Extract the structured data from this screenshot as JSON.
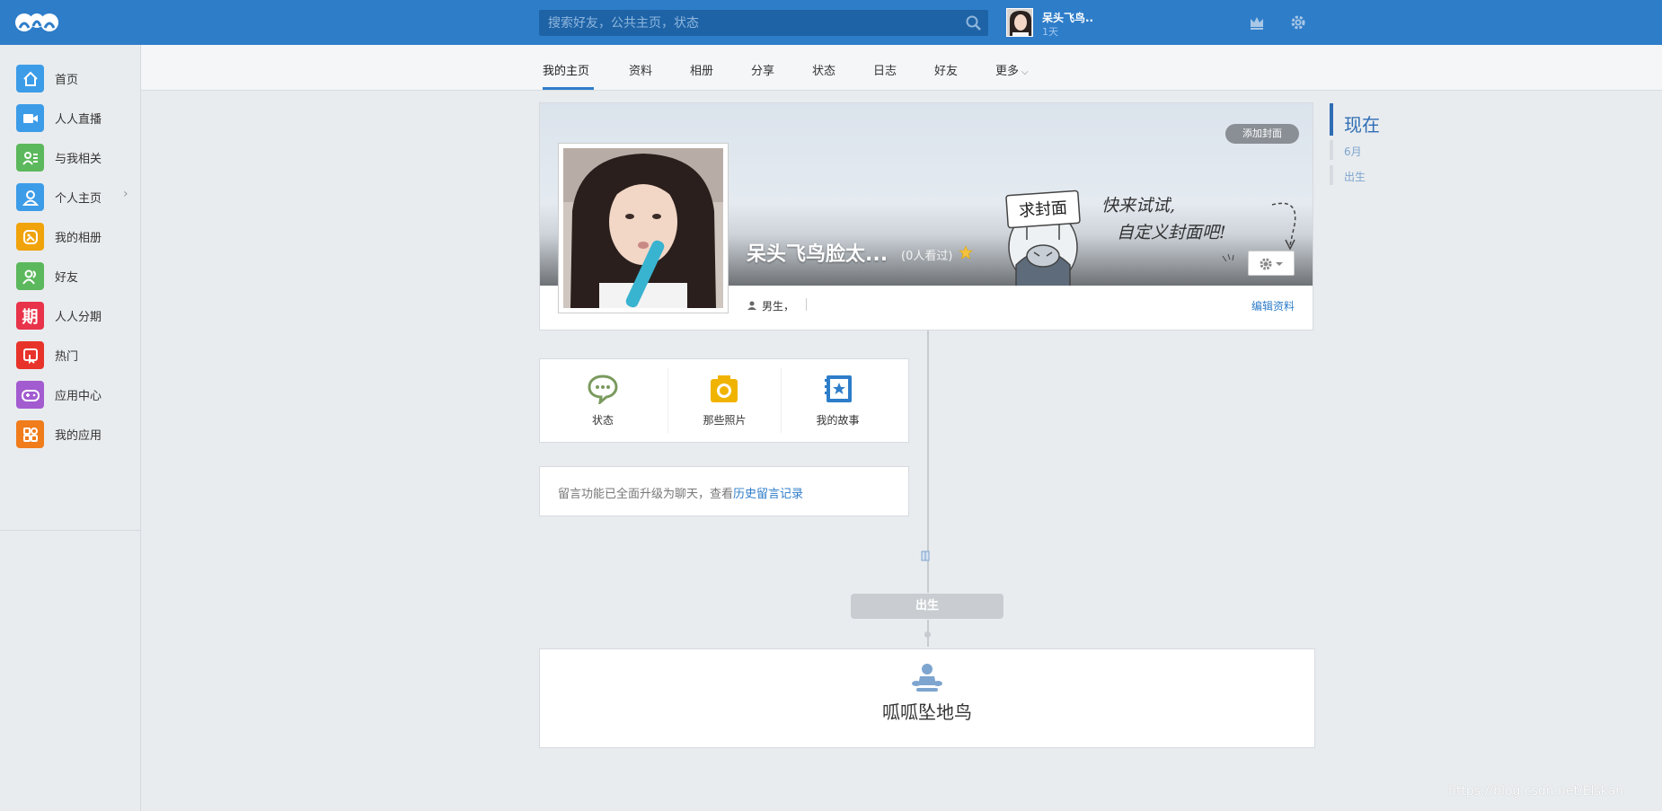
{
  "topbar": {
    "search_placeholder": "搜索好友，公共主页，状态",
    "user_name": "呆头飞鸟..",
    "user_time": "1天",
    "brand_color": "#2e7dc9"
  },
  "sidebar": {
    "items": [
      {
        "label": "首页",
        "icon": "home-icon",
        "color": "#3c9ce8"
      },
      {
        "label": "人人直播",
        "icon": "video-icon",
        "color": "#3c9ce8"
      },
      {
        "label": "与我相关",
        "icon": "related-icon",
        "color": "#5cb85c"
      },
      {
        "label": "个人主页",
        "icon": "person-icon",
        "color": "#3c9ce8"
      },
      {
        "label": "我的相册",
        "icon": "album-icon",
        "color": "#f0a30a"
      },
      {
        "label": "好友",
        "icon": "friends-icon",
        "color": "#5cb85c"
      },
      {
        "label": "人人分期",
        "icon": "installment-icon",
        "color": "#e8334a",
        "glyph": "期"
      },
      {
        "label": "热门",
        "icon": "hot-icon",
        "color": "#e8332a"
      },
      {
        "label": "应用中心",
        "icon": "gamepad-icon",
        "color": "#a35bd0"
      },
      {
        "label": "我的应用",
        "icon": "apps-icon",
        "color": "#f07c1b"
      }
    ]
  },
  "subnav": {
    "tabs": [
      "我的主页",
      "资料",
      "相册",
      "分享",
      "状态",
      "日志",
      "好友",
      "更多"
    ]
  },
  "profile": {
    "add_cover": "添加封面",
    "name": "呆头飞鸟脸太...",
    "views": "(0人看过)",
    "gender": "男生，",
    "edit_profile": "编辑资料",
    "cover_sign": "求封面",
    "cover_text_line1": "快来试试,",
    "cover_text_line2": "自定义封面吧!"
  },
  "publish": {
    "items": [
      {
        "label": "状态",
        "icon": "chat-icon",
        "color": "#7a9a5e"
      },
      {
        "label": "那些照片",
        "icon": "camera-icon",
        "color": "#f0b400"
      },
      {
        "label": "我的故事",
        "icon": "story-icon",
        "color": "#2e7dc9"
      }
    ]
  },
  "message": {
    "text": "留言功能已全面升级为聊天，查看",
    "link": "历史留言记录"
  },
  "birth": {
    "button": "出生",
    "title": "呱呱坠地鸟"
  },
  "rnav": {
    "now": "现在",
    "month": "6月",
    "birth": "出生"
  },
  "watermark": "https://blog.csdn.net/Elskan"
}
